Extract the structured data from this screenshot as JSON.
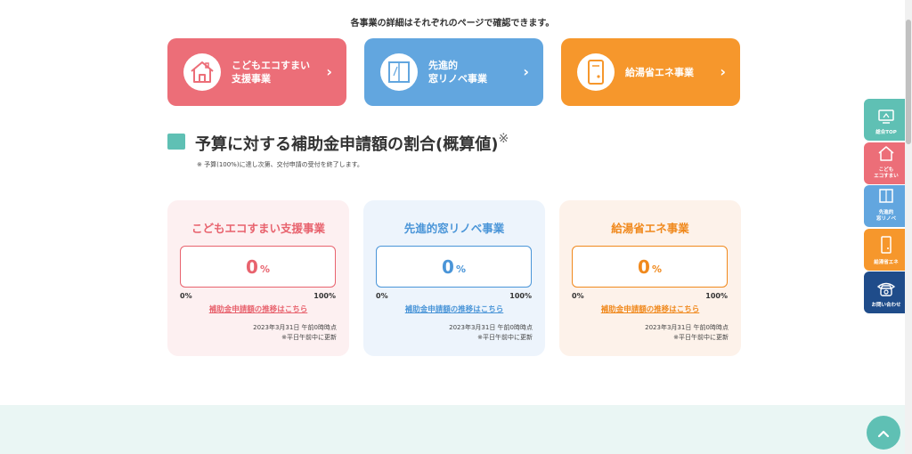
{
  "intro": "各事業の詳細はそれぞれのページで確認できます。",
  "nav_buttons": [
    {
      "label": "こどもエコすまい\n支援事業",
      "icon": "house-icon",
      "color": "#ec6e78"
    },
    {
      "label": "先進的\n窓リノベ事業",
      "icon": "window-icon",
      "color": "#62a6df"
    },
    {
      "label": "給湯省エネ事業",
      "icon": "water-heater-icon",
      "color": "#f6972c"
    }
  ],
  "chevron": "›",
  "section": {
    "title": "予算に対する補助金申請額の割合(概算値)",
    "title_mark": "※",
    "note": "※ 予算(100%)に達し次第、交付申請の受付を終了します。"
  },
  "cards": [
    {
      "title": "こどもエコすまい支援事業",
      "value": "0",
      "unit": "%",
      "min": "0%",
      "max": "100%",
      "link": "補助金申請額の推移はこちら",
      "date": "2023年3月31日 午前0時時点",
      "update": "※平日午前中に更新",
      "color": "#e8636e"
    },
    {
      "title": "先進的窓リノベ事業",
      "value": "0",
      "unit": "%",
      "min": "0%",
      "max": "100%",
      "link": "補助金申請額の推移はこちら",
      "date": "2023年3月31日 午前0時時点",
      "update": "※平日午前中に更新",
      "color": "#4a95d8"
    },
    {
      "title": "給湯省エネ事業",
      "value": "0",
      "unit": "%",
      "min": "0%",
      "max": "100%",
      "link": "補助金申請額の推移はこちら",
      "date": "2023年3月31日 午前0時時点",
      "update": "※平日午前中に更新",
      "color": "#f0891d"
    }
  ],
  "side_nav": [
    {
      "label": "総合TOP",
      "icon": "monitor-icon"
    },
    {
      "label": "こども\nエコすまい",
      "icon": "house-icon"
    },
    {
      "label": "先進的\n窓リノベ",
      "icon": "window-icon"
    },
    {
      "label": "給湯省エネ",
      "icon": "water-heater-icon"
    },
    {
      "label": "お問い合わせ",
      "icon": "phone-icon"
    }
  ],
  "back_to_top_icon": "chevron-up-icon"
}
